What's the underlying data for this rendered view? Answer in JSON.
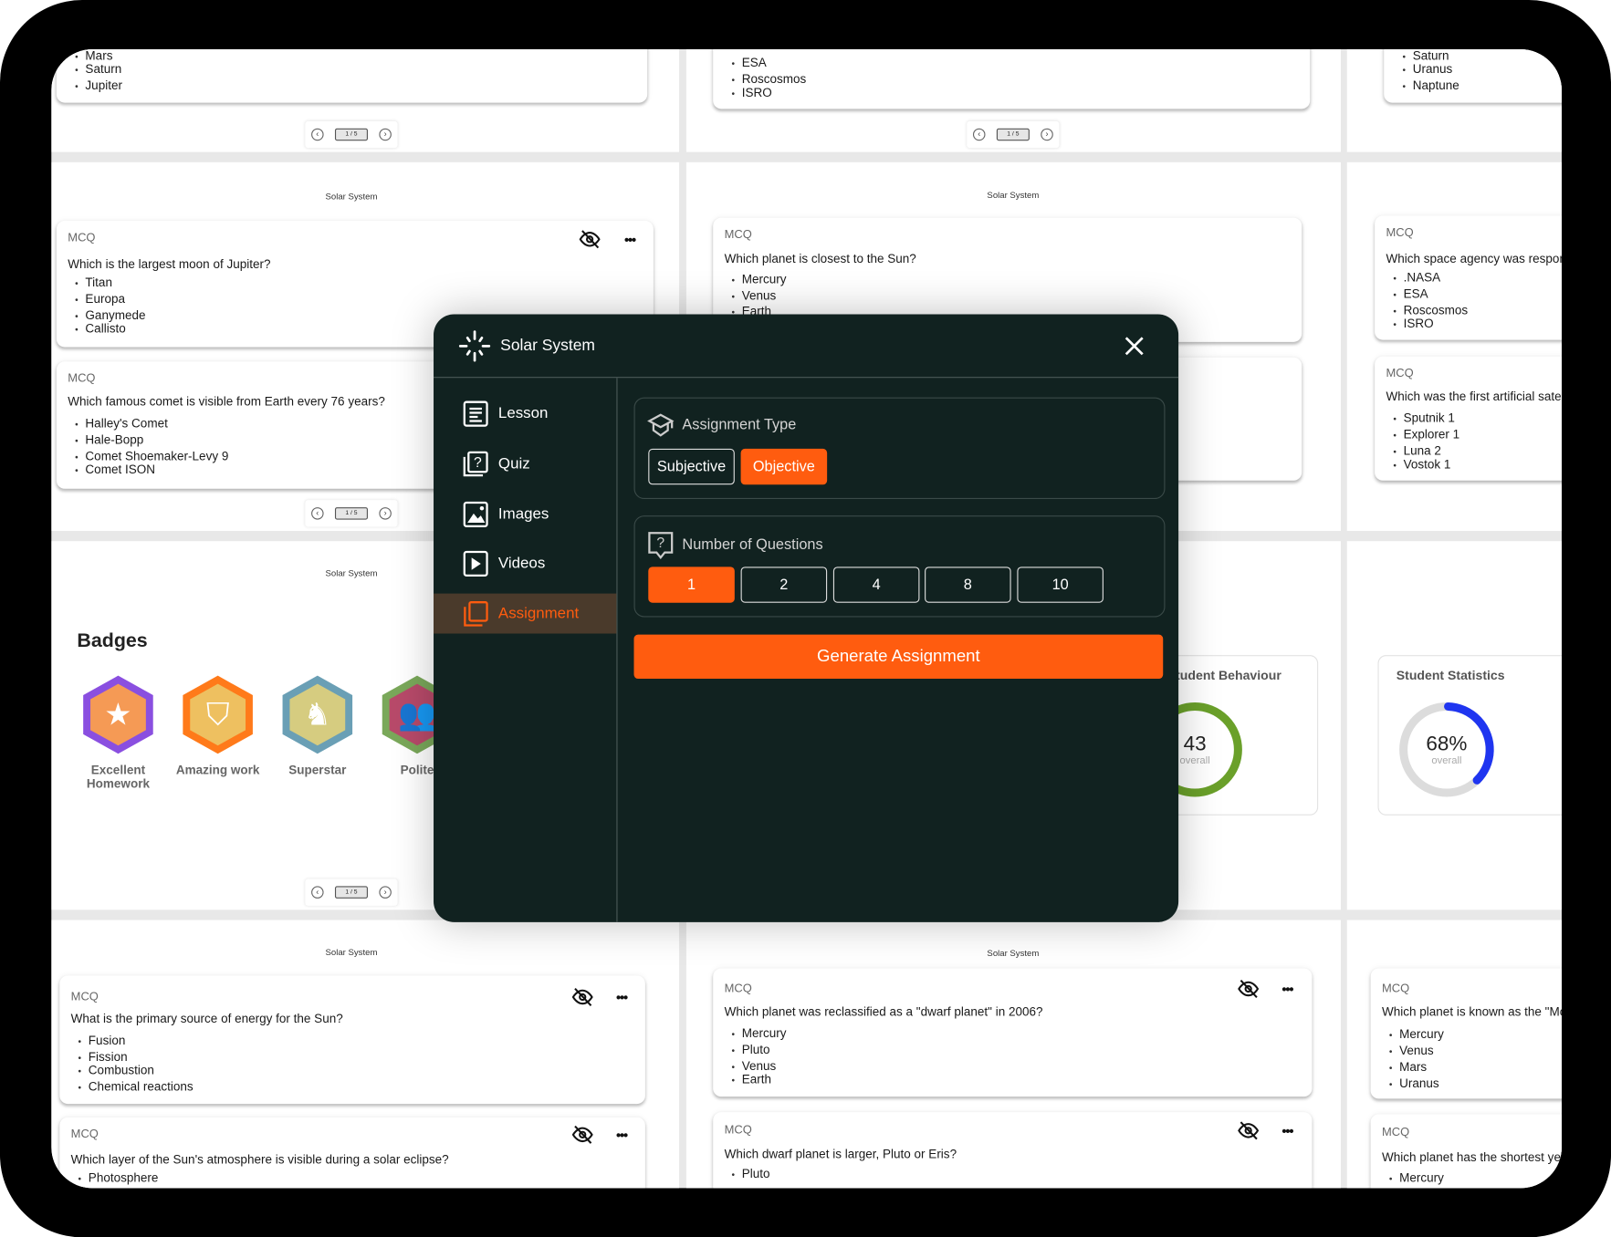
{
  "panels": [
    {
      "pager": "1 / 5",
      "cards": [
        {
          "options": [
            "Mars",
            "Saturn",
            "Jupiter"
          ]
        }
      ]
    },
    {
      "pager": "1 / 5",
      "cards": [
        {
          "options": [
            "ESA",
            "Roscosmos",
            "ISRO"
          ]
        }
      ]
    },
    {
      "cards": [
        {
          "options": [
            "Saturn",
            "Uranus",
            "Naptune"
          ]
        }
      ]
    },
    {
      "label": "Solar System",
      "pager": "1 / 5",
      "cards": [
        {
          "type": "MCQ",
          "question": "Which is the largest moon of Jupiter?",
          "options": [
            "Titan",
            "Europa",
            "Ganymede",
            "Callisto"
          ]
        },
        {
          "type": "MCQ",
          "question": "Which famous comet is visible from Earth every 76 years?",
          "options": [
            "Halley's Comet",
            "Hale-Bopp",
            "Comet Shoemaker-Levy 9",
            "Comet ISON"
          ]
        }
      ]
    },
    {
      "label": "Solar System",
      "cards": [
        {
          "type": "MCQ",
          "question": "Which planet is closest to the Sun?",
          "options": [
            "Mercury",
            "Venus",
            "Earth"
          ]
        }
      ]
    },
    {
      "cards": [
        {
          "type": "MCQ",
          "question": "Which space agency was respon",
          "options": [
            ".NASA",
            "ESA",
            "Roscosmos",
            "ISRO"
          ]
        },
        {
          "type": "MCQ",
          "question": "Which was the first artificial sate",
          "options": [
            "Sputnik 1",
            "Explorer 1",
            "Luna 2",
            "Vostok 1"
          ]
        }
      ]
    },
    {
      "label": "Solar System",
      "cards": [
        {
          "type": "MCQ",
          "question": "What is the primary source of energy for the Sun?",
          "options": [
            "Fusion",
            "Fission",
            "Combustion",
            "Chemical reactions"
          ]
        },
        {
          "type": "MCQ",
          "question": "Which layer of the Sun's atmosphere is visible during a solar eclipse?",
          "options": [
            "Photosphere"
          ]
        }
      ]
    },
    {
      "label": "Solar System",
      "cards": [
        {
          "type": "MCQ",
          "question": "Which planet was reclassified as a \"dwarf planet\" in 2006?",
          "options": [
            "Mercury",
            "Pluto",
            "Venus",
            "Earth"
          ]
        },
        {
          "type": "MCQ",
          "question": "Which dwarf planet is larger, Pluto or Eris?",
          "options": [
            "Pluto"
          ]
        }
      ]
    },
    {
      "cards": [
        {
          "type": "MCQ",
          "question": "Which planet is known as the \"Mo",
          "options": [
            "Mercury",
            "Venus",
            "Mars",
            "Uranus"
          ]
        },
        {
          "type": "MCQ",
          "question": "Which planet has the shortest yea",
          "options": [
            "Mercury"
          ]
        }
      ]
    }
  ],
  "badges_panel": {
    "label": "Solar System",
    "pager": "1 / 5",
    "title": "Badges",
    "badges": [
      {
        "name": "Excellent Homework",
        "icon": "star-icon",
        "color": "#8a4fe0"
      },
      {
        "name": "Amazing work",
        "icon": "shield-star-icon",
        "color": "#ff7a1a"
      },
      {
        "name": "Superstar",
        "icon": "horse-icon",
        "color": "#6a9fb5"
      },
      {
        "name": "Polite",
        "icon": "group-icon",
        "color": "#7aa85a"
      }
    ]
  },
  "stats": {
    "behaviour": {
      "title": "Student Behaviour",
      "value": "43",
      "sub": "overall",
      "color": "#6aa02a"
    },
    "statistics": {
      "title": "Student Statistics",
      "value": "68%",
      "sub": "overall",
      "color": "#1f35f0",
      "percent": 68
    }
  },
  "modal": {
    "title": "Solar System",
    "accent": "#ff5c0f",
    "nav": [
      {
        "label": "Lesson",
        "icon": "lesson-icon"
      },
      {
        "label": "Quiz",
        "icon": "quiz-icon"
      },
      {
        "label": "Images",
        "icon": "image-icon"
      },
      {
        "label": "Videos",
        "icon": "video-icon"
      },
      {
        "label": "Assignment",
        "icon": "assignment-icon",
        "active": true
      }
    ],
    "assignment_type": {
      "heading": "Assignment Type",
      "options": [
        "Subjective",
        "Objective"
      ],
      "selected": "Objective"
    },
    "num_questions": {
      "heading": "Number of Questions",
      "options": [
        "1",
        "2",
        "4",
        "8",
        "10"
      ],
      "selected": "1"
    },
    "generate_label": "Generate Assignment"
  }
}
